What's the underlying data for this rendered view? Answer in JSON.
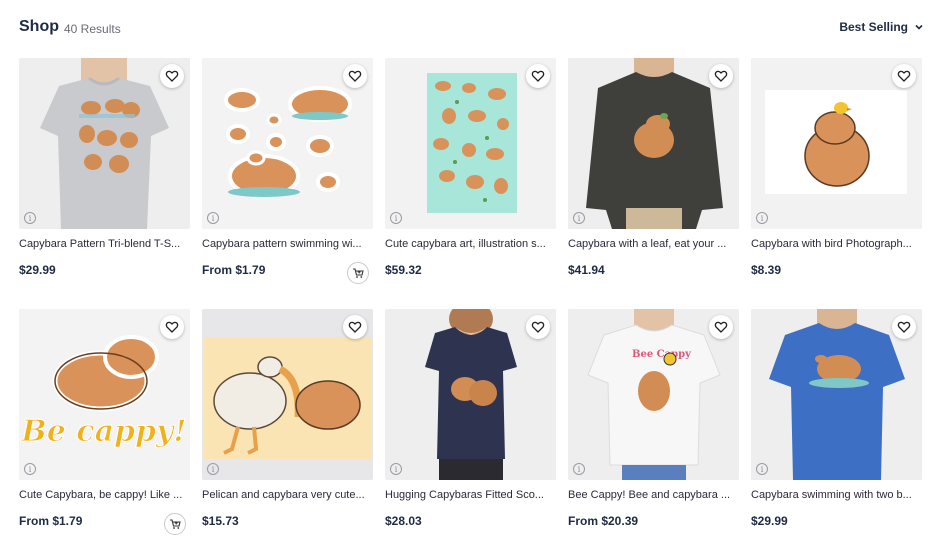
{
  "header": {
    "title": "Shop",
    "results": "40 Results",
    "sort_label": "Best Selling"
  },
  "products": [
    {
      "title": "Capybara Pattern Tri-blend T-S...",
      "price": "$29.99",
      "has_cart": false
    },
    {
      "title": "Capybara pattern swimming wi...",
      "price": "From $1.79",
      "has_cart": true
    },
    {
      "title": "Cute capybara art, illustration s...",
      "price": "$59.32",
      "has_cart": false
    },
    {
      "title": "Capybara with a leaf, eat your ...",
      "price": "$41.94",
      "has_cart": false
    },
    {
      "title": "Capybara with bird Photograph...",
      "price": "$8.39",
      "has_cart": false
    },
    {
      "title": "Cute Capybara, be cappy! Like ...",
      "price": "From $1.79",
      "has_cart": true
    },
    {
      "title": "Pelican and capybara very cute...",
      "price": "$15.73",
      "has_cart": false
    },
    {
      "title": "Hugging Capybaras Fitted Sco...",
      "price": "$28.03",
      "has_cart": false
    },
    {
      "title": "Bee Cappy! Bee and capybara ...",
      "price": "From $20.39",
      "has_cart": false
    },
    {
      "title": "Capybara swimming with two b...",
      "price": "$29.99",
      "has_cart": false
    }
  ],
  "artwork": {
    "be_cappy_text": "Be cappy!",
    "bee_cappy_text": "Bee Cappy"
  },
  "colors": {
    "accent": "#1f2a44",
    "capybara": "#d9925a",
    "sticker_text": "#f0b21b"
  }
}
